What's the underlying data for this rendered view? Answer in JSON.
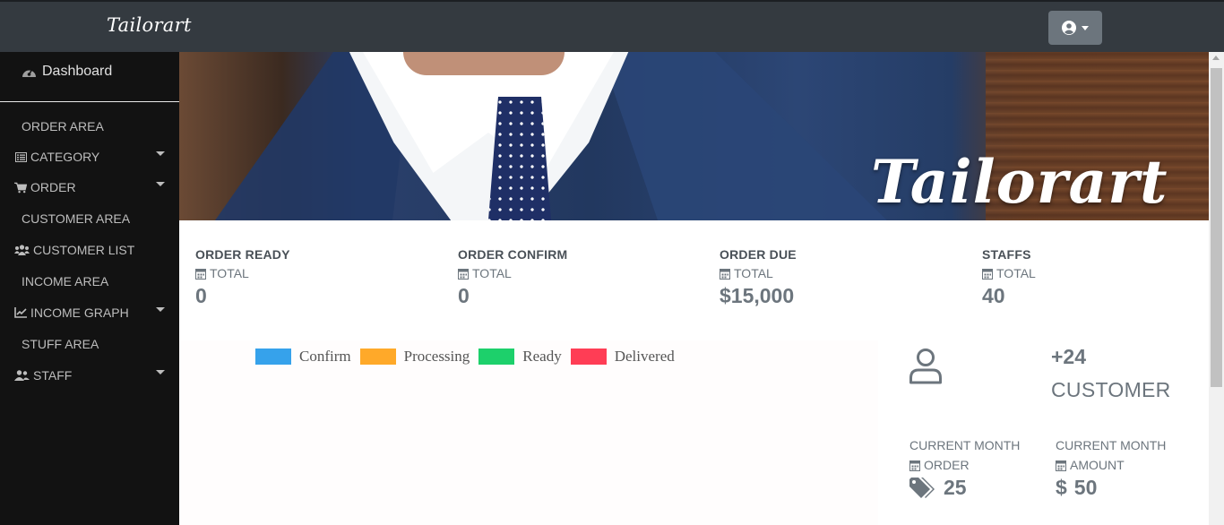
{
  "header": {
    "brand": "Tailorart"
  },
  "sidebar": {
    "dashboard": "Dashboard",
    "items": [
      {
        "label": "ORDER AREA",
        "icon": "",
        "caret": false
      },
      {
        "label": "CATEGORY",
        "icon": "list-icon",
        "caret": true
      },
      {
        "label": "ORDER",
        "icon": "cart-icon",
        "caret": true
      },
      {
        "label": "CUSTOMER AREA",
        "icon": "",
        "caret": false
      },
      {
        "label": "CUSTOMER LIST",
        "icon": "users-icon",
        "caret": false
      },
      {
        "label": "INCOME AREA",
        "icon": "",
        "caret": false
      },
      {
        "label": "INCOME GRAPH",
        "icon": "chart-line-icon",
        "caret": true
      },
      {
        "label": "STUFF AREA",
        "icon": "",
        "caret": false
      },
      {
        "label": "STAFF",
        "icon": "user-friends-icon",
        "caret": true
      }
    ]
  },
  "banner": {
    "title": "Tailorart"
  },
  "stats": [
    {
      "title": "ORDER READY",
      "sub": "TOTAL",
      "value": "0"
    },
    {
      "title": "ORDER CONFIRM",
      "sub": "TOTAL",
      "value": "0"
    },
    {
      "title": "ORDER DUE",
      "sub": "TOTAL",
      "value": "$15,000"
    },
    {
      "title": "STAFFS",
      "sub": "TOTAL",
      "value": "40"
    }
  ],
  "chart_data": {
    "type": "bar",
    "series": [
      {
        "name": "Confirm",
        "color": "#36a2eb"
      },
      {
        "name": "Processing",
        "color": "#ffa929"
      },
      {
        "name": "Ready",
        "color": "#1dd06b"
      },
      {
        "name": "Delivered",
        "color": "#ff3d55"
      }
    ]
  },
  "customers": {
    "count": "+24",
    "label": "CUSTOMER"
  },
  "current_month": [
    {
      "title": "CURRENT MONTH",
      "sub": "ORDER",
      "value": "25",
      "icon": "tags-icon"
    },
    {
      "title": "CURRENT MONTH",
      "sub": "AMOUNT",
      "value": "50",
      "icon": "dollar-icon",
      "prefix": "$"
    }
  ]
}
